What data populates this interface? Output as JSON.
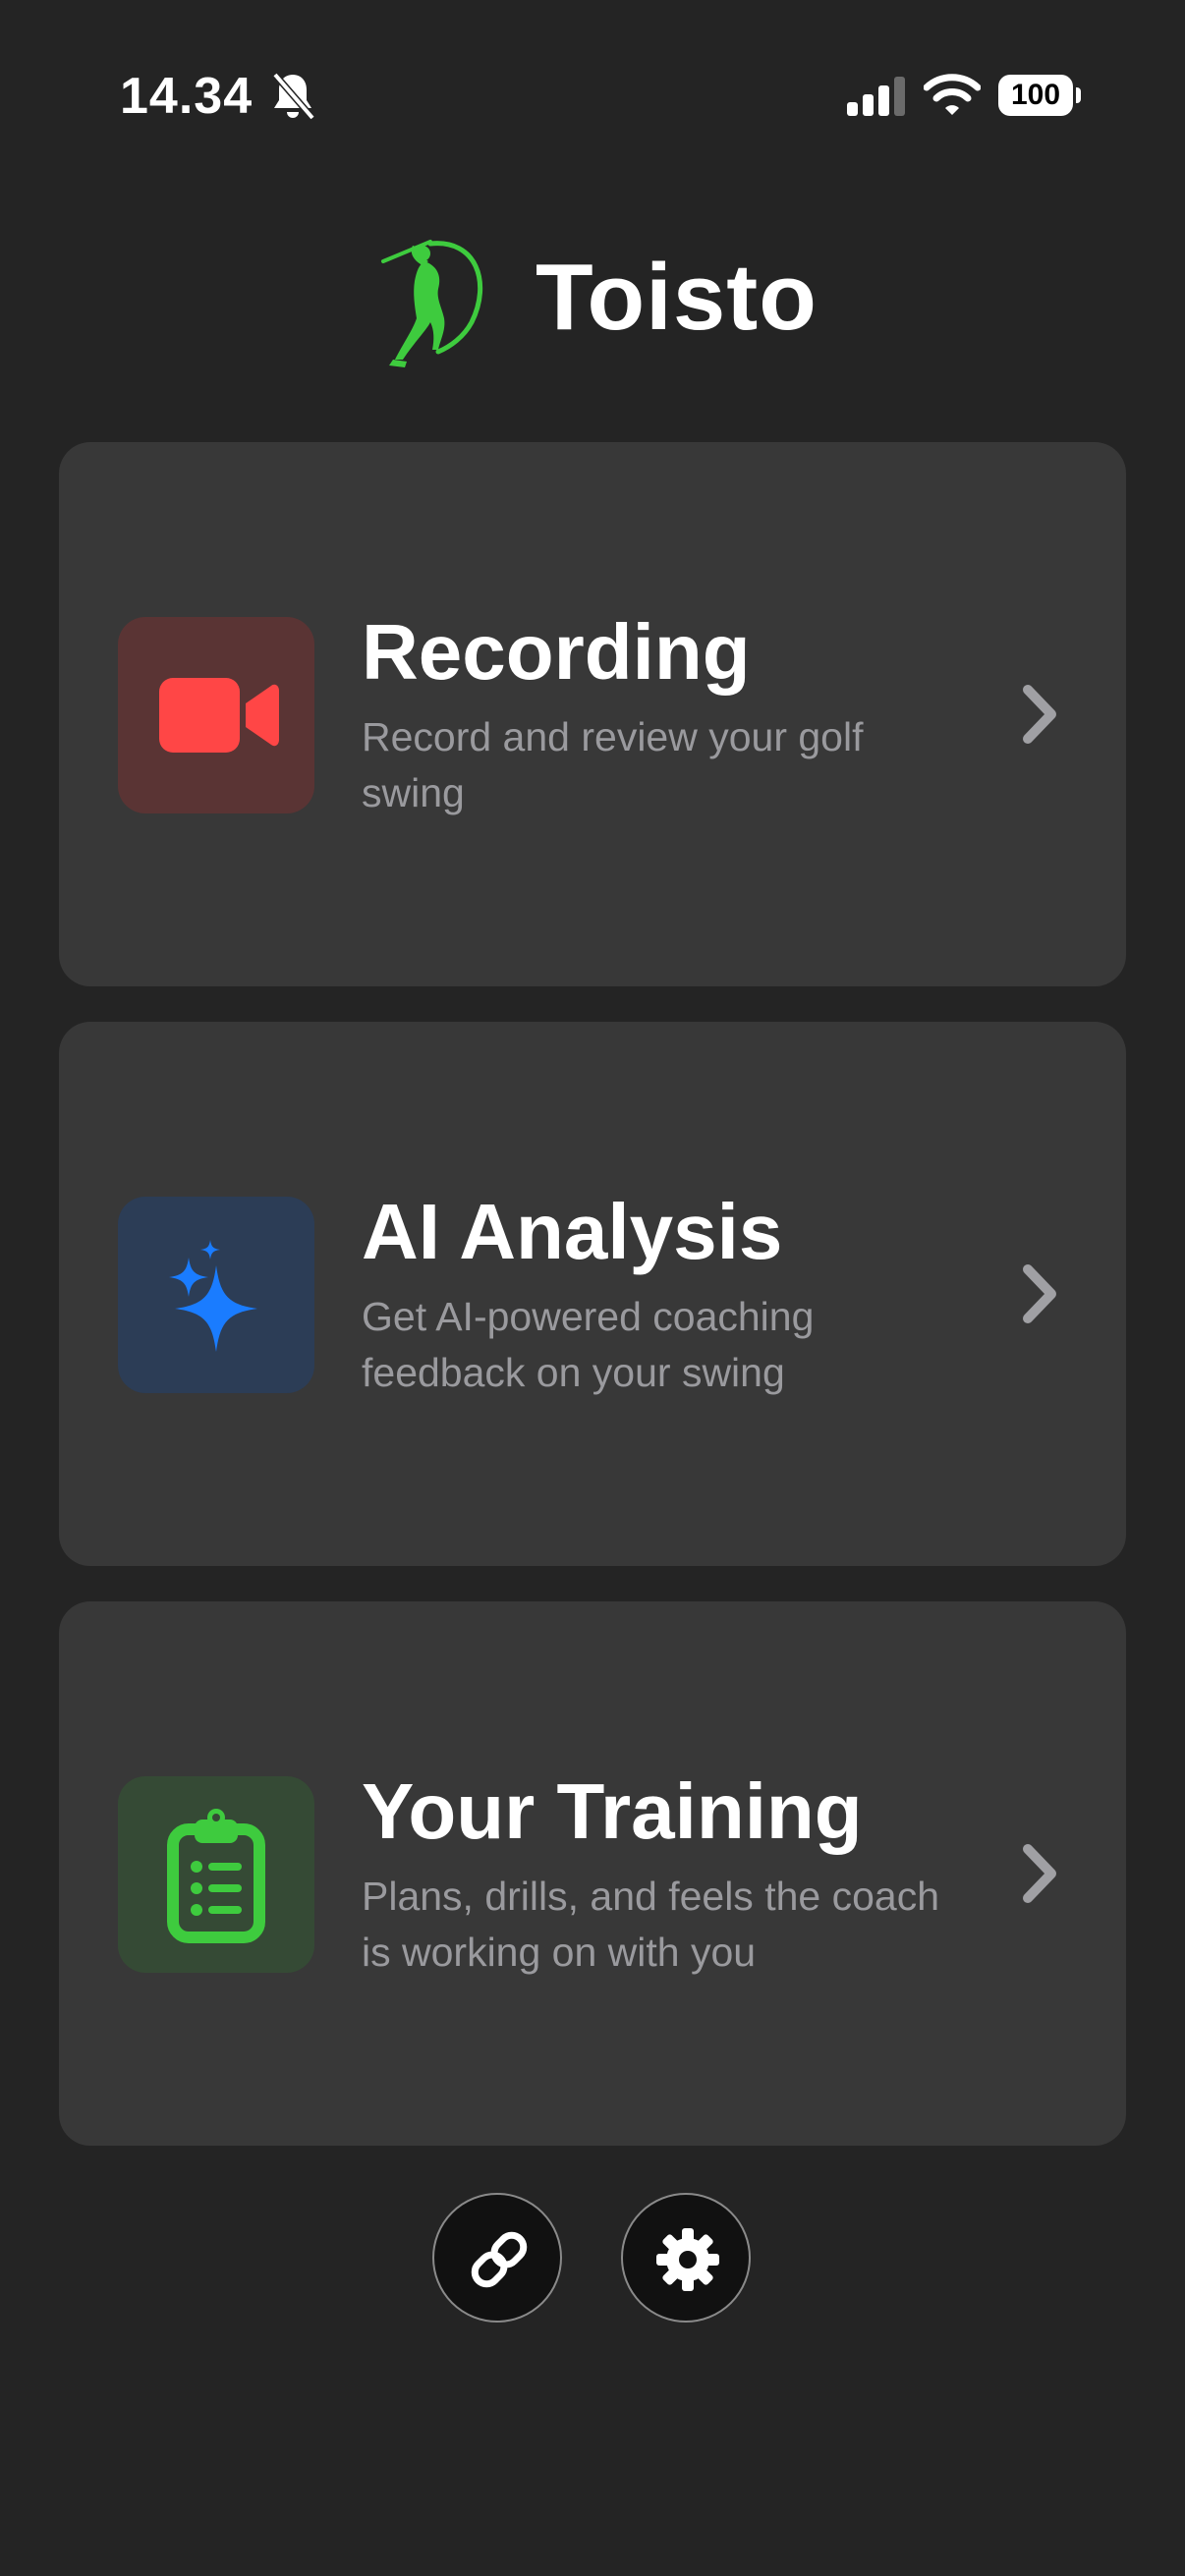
{
  "status_bar": {
    "time": "14.34",
    "battery_level": "100",
    "icons": [
      "bell-slash-icon",
      "cellular-signal-icon",
      "wifi-icon",
      "battery-icon"
    ]
  },
  "header": {
    "title": "Toisto",
    "logo": "golfer-logo-icon"
  },
  "cards": [
    {
      "title": "Recording",
      "subtitle": "Record and review your golf swing",
      "icon": "video-camera-icon",
      "accent": "#ff4646",
      "icon_bg": "#5a3434"
    },
    {
      "title": "AI Analysis",
      "subtitle": "Get AI-powered coaching feedback on your swing",
      "icon": "sparkles-icon",
      "accent": "#1a7cff",
      "icon_bg": "#2c3d56"
    },
    {
      "title": "Your Training",
      "subtitle": "Plans, drills, and feels the coach is working on with you",
      "icon": "clipboard-list-icon",
      "accent": "#3ecb3e",
      "icon_bg": "#354a35"
    }
  ],
  "bottom_buttons": [
    {
      "icon": "link-icon"
    },
    {
      "icon": "gear-icon"
    }
  ],
  "colors": {
    "background": "#242424",
    "card": "#383838",
    "subtitle_text": "#9a9a9e",
    "brand_green": "#3ecb3e"
  }
}
